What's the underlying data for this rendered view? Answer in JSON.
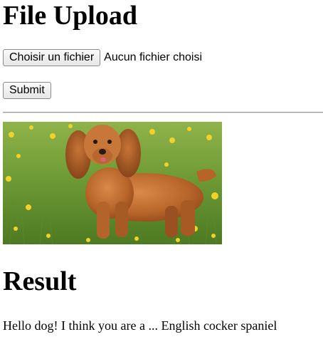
{
  "page": {
    "title": "File Upload"
  },
  "upload_form": {
    "choose_button_label": "Choisir un fichier",
    "file_status": "Aucun fichier choisi",
    "submit_label": "Submit"
  },
  "uploaded_image": {
    "subject": "dog"
  },
  "result": {
    "heading": "Result",
    "message": "Hello dog! I think you are a ... English cocker spaniel"
  }
}
